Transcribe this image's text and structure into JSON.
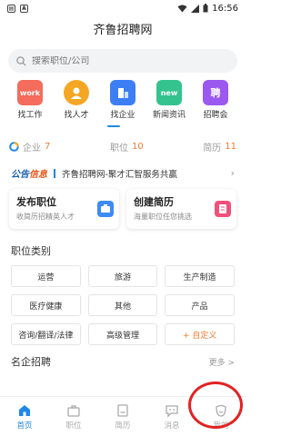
{
  "status_bar": {
    "time": "16:56"
  },
  "header": {
    "title": "齐鲁招聘网"
  },
  "search": {
    "placeholder": "搜索职位/公司"
  },
  "nav": [
    {
      "label": "找工作",
      "badge": "work",
      "color": "#f36c5c"
    },
    {
      "label": "找人才",
      "color": "#f5a623"
    },
    {
      "label": "找企业",
      "color": "#3d7ef5"
    },
    {
      "label": "新闻资讯",
      "badge": "new",
      "color": "#34c38f"
    },
    {
      "label": "招聘会",
      "badge": "聘",
      "color": "#9b59f0"
    }
  ],
  "stats": [
    {
      "label": "企业",
      "value": "7"
    },
    {
      "label": "职位",
      "value": "10"
    },
    {
      "label": "简历",
      "value": "11"
    }
  ],
  "notice": {
    "logo_a": "公告",
    "logo_b": "信息",
    "text": "齐鲁招聘网-聚才汇智服务共赢"
  },
  "cards": [
    {
      "title": "发布职位",
      "subtitle": "收简历招精英人才",
      "color": "#3d8bf5"
    },
    {
      "title": "创建简历",
      "subtitle": "海量职位任您挑选",
      "color": "#f0507a"
    }
  ],
  "categories_title": "职位类别",
  "categories": [
    "运营",
    "旅游",
    "生产制造",
    "医疗健康",
    "其他",
    "产品",
    "咨询/翻译/法律",
    "高级管理",
    "+ 自定义"
  ],
  "famous": {
    "title": "名企招聘",
    "more": "更多 >"
  },
  "tabs": [
    {
      "label": "首页"
    },
    {
      "label": "职位"
    },
    {
      "label": "简历"
    },
    {
      "label": "消息"
    },
    {
      "label": "我的"
    }
  ]
}
